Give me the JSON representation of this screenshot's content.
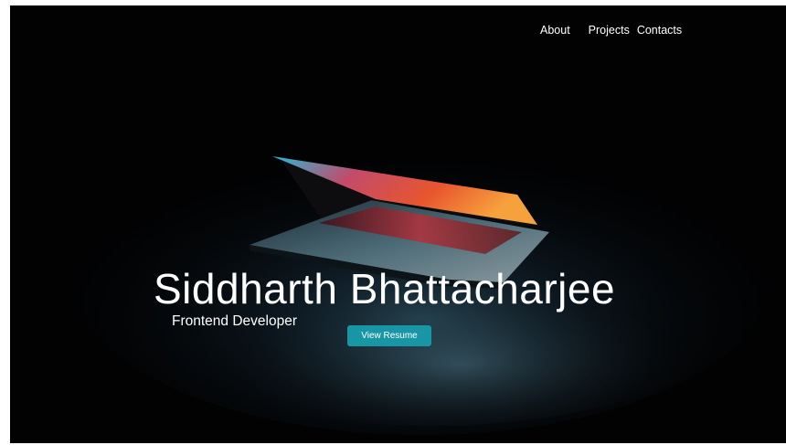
{
  "nav": {
    "items": [
      {
        "label": "About"
      },
      {
        "label": "Projects"
      },
      {
        "label": "Contacts"
      }
    ]
  },
  "hero": {
    "name": "Siddharth Bhattacharjee",
    "role": "Frontend Developer",
    "resume_label": "View Resume",
    "background_image": "laptop-photo",
    "colors": {
      "background": "#020203",
      "text": "#ffffff",
      "button": "#1896a6"
    }
  }
}
